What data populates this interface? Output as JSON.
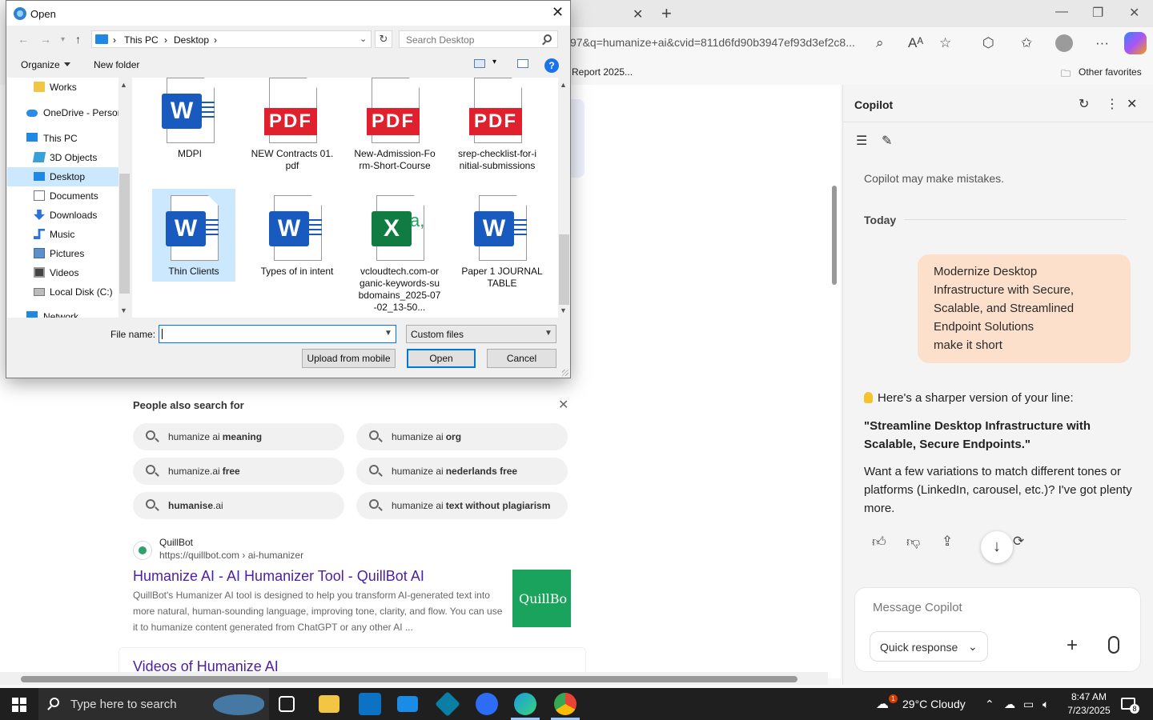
{
  "browser": {
    "url": "97&q=humanize+ai&cvid=811d6fd90b3947ef93d3ef2c8...",
    "favorites": [
      "Report 2025...",
      "Other favorites"
    ]
  },
  "page": {
    "people_also_search_title": "People also search for",
    "suggestions": [
      {
        "prefix": "humanize ai",
        "bold": "meaning"
      },
      {
        "prefix": "humanize ai",
        "bold": "org"
      },
      {
        "prefix": "humanize.ai",
        "bold": "free"
      },
      {
        "prefix": "humanize ai",
        "bold": "nederlands free"
      },
      {
        "prefix": "",
        "bold": "humanise",
        "suffix": ".ai"
      },
      {
        "prefix": "humanize ai",
        "bold": "text without plagiarism"
      }
    ],
    "result": {
      "site": "QuillBot",
      "url": "https://quillbot.com › ai-humanizer",
      "title": "Humanize AI - AI Humanizer Tool - QuillBot AI",
      "snippet": "QuillBot's Humanizer AI tool is designed to help you transform AI-generated text into more natural, human-sounding language, improving tone, clarity, and flow. You can use it to humanize content generated from ChatGPT or any other AI ...",
      "thumb_text": "QuillBo"
    },
    "videos_title": "Videos of Humanize AI"
  },
  "copilot": {
    "title": "Copilot",
    "note": "Copilot may make mistakes.",
    "today": "Today",
    "user_message": [
      "Modernize Desktop",
      "Infrastructure with Secure,",
      "Scalable, and Streamlined",
      "Endpoint Solutions",
      "make it short"
    ],
    "reply_intro": "Here's a sharper version of your line:",
    "reply_quote": "\"Streamline Desktop Infrastructure with Scalable, Secure Endpoints.\"",
    "reply_followup": "Want a few variations to match different tones or platforms (LinkedIn, carousel, etc.)? I've got plenty more.",
    "input_placeholder": "Message Copilot",
    "mode": "Quick response"
  },
  "dialog": {
    "title": "Open",
    "breadcrumb": [
      "This PC",
      "Desktop"
    ],
    "search_placeholder": "Search Desktop",
    "organize": "Organize",
    "new_folder": "New folder",
    "nav_items": [
      {
        "label": "Works",
        "icon": "folder-icon"
      },
      {
        "label": "OneDrive - Persor",
        "icon": "cloud-icon"
      },
      {
        "label": "This PC",
        "icon": "pc-icon"
      },
      {
        "label": "3D Objects",
        "icon": "cube-icon"
      },
      {
        "label": "Desktop",
        "icon": "desktop-icon",
        "selected": true
      },
      {
        "label": "Documents",
        "icon": "documents-icon"
      },
      {
        "label": "Downloads",
        "icon": "downloads-icon"
      },
      {
        "label": "Music",
        "icon": "music-icon"
      },
      {
        "label": "Pictures",
        "icon": "pictures-icon"
      },
      {
        "label": "Videos",
        "icon": "videos-icon"
      },
      {
        "label": "Local Disk (C:)",
        "icon": "disk-icon"
      },
      {
        "label": "Network",
        "icon": "network-icon"
      }
    ],
    "files": [
      {
        "name": "MDPI",
        "type": "word"
      },
      {
        "name": "NEW Contracts 01.pdf",
        "type": "pdf"
      },
      {
        "name": "New-Admission-Form-Short-Course",
        "type": "pdf"
      },
      {
        "name": "srep-checklist-for-initial-submissions",
        "type": "pdf"
      },
      {
        "name": "Thin Clients",
        "type": "word",
        "selected": true
      },
      {
        "name": "Types of in intent",
        "type": "word"
      },
      {
        "name": "vcloudtech.com-organic-keywords-subdomains_2025-07-02_13-50...",
        "type": "excel"
      },
      {
        "name": "Paper 1 JOURNAL TABLE",
        "type": "word"
      }
    ],
    "file_name_label": "File name:",
    "file_name_value": "",
    "file_type": "Custom files",
    "buttons": {
      "upload": "Upload from mobile",
      "open": "Open",
      "cancel": "Cancel"
    }
  },
  "taskbar": {
    "search_placeholder": "Type here to search",
    "weather": "29°C  Cloudy",
    "weather_badge": "1",
    "time": "8:47 AM",
    "date": "7/23/2025",
    "notifications": "8"
  },
  "colors": {
    "accent": "#0078d4",
    "link": "#4b1fa6",
    "word": "#185abd",
    "excel": "#107c41",
    "pdf": "#e0202c",
    "bubble": "#fde0cc"
  }
}
